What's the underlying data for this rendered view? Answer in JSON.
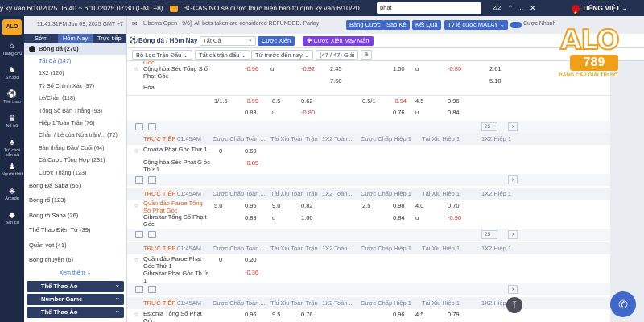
{
  "topbar": {
    "marquee": "ỳ kỳ vào 6/10/2025 06:40 ~ 6/10/2025 07:30 (GMT+8)",
    "notice": "BGCASINO sẽ được thực hiện bảo trì định kỳ vào 6/10/20",
    "search_value": "phạt",
    "page_indicator": "2/2",
    "language": "TIẾNG VIỆT"
  },
  "rail": {
    "logo": "ALO",
    "items": [
      "Trang chủ",
      "SV388",
      "Thể thao",
      "Nổ hũ",
      "Trò chơi bắn cá",
      "Người thật",
      "Arcade",
      "Bắn cá"
    ]
  },
  "sidebar": {
    "timestamp": "11:41:31PM Jun 09, 2025 GMT +7",
    "tabs": [
      "Sớm",
      "Hôm Nay",
      "Trực tiếp"
    ],
    "sport_head": "Bóng đá (270)",
    "sub_items": [
      "Tất Cả (147)",
      "1X2 (120)",
      "Tỷ Số Chính Xác (97)",
      "Lẻ/Chẵn (118)",
      "Tổng Số Bàn Thắng (93)",
      "Hiệp 1/Toàn Trận (76)",
      "Chẵn / Lẻ của Nửa trận/... (72)",
      "Bàn thắng Đầu/ Cuối (64)",
      "Cả Cược Tổng Hợp (231)",
      "Cược Thắng (123)"
    ],
    "others": [
      {
        "label": "Bóng Đá Saba (56)",
        "color": "#e05a1e"
      },
      {
        "label": "Bóng rổ (123)",
        "color": "#f08a24"
      },
      {
        "label": "Bóng rổ Saba (26)",
        "color": "#f08a24"
      },
      {
        "label": "Thể Thao Điện Tử (39)",
        "color": "#7a8599"
      },
      {
        "label": "Quần vợt (41)",
        "color": "#9bc53d"
      },
      {
        "label": "Bóng chuyền (6)",
        "color": "#3f68c9"
      }
    ],
    "more": "Xem thêm",
    "bands": [
      "Thể Thao Ảo",
      "Number Game",
      "Thể Thao Ảo"
    ]
  },
  "header": {
    "announcement": "Libema Open - 9/6]. All bets taken are considered REFUNDED. Parlay",
    "buttons": [
      "Bảng Cược",
      "Sao Kê",
      "Kết Quả",
      "Tỷ lệ cược MALAY"
    ],
    "toggle_label": "Cược Nhanh",
    "extra_label": "Chế độ gốc tối"
  },
  "filterbar": {
    "title": "Bóng đá / Hôm Nay",
    "select": "Tất Cả",
    "btn_parlay": "Cược Xiên",
    "btn_lucky": "Cược Xiên May Mắn"
  },
  "controls": {
    "filter": "Bộ Lọc Trận Đấu",
    "all_matches": "Tất cả trận đấu",
    "sort": "Từ trước đến nay",
    "count": "(47 / 47) Giải"
  },
  "headers": [
    "Cược Chấp Toàn ...",
    "Tài Xỉu Toàn Trận",
    "1X2 Toàn ...",
    "Cược Chấp Hiệp 1",
    "Tài Xỉu Hiệp 1",
    "1X2 Hiệp 1"
  ],
  "live": "TRỰC TIẾP",
  "blocks": {
    "b0": {
      "top_label": "Góc",
      "home": "Cộng hòa Séc Tổng S ố Phạt Góc",
      "draw": "Hòa",
      "r1": {
        "a": "-0.96",
        "b": "u",
        "c": "-0.92",
        "d": "2.45",
        "e": "1.00",
        "f": "u",
        "g": "-0.85",
        "h": "2.61"
      },
      "r2": {
        "d": "7.50",
        "h": "5.10"
      },
      "r3": {
        "a": "1/1.5",
        "b": "-0.99",
        "c": "8.5",
        "d": "0.62",
        "e": "0.5/1",
        "f": "-0.94",
        "g": "4.5",
        "h": "0.96"
      },
      "r4": {
        "b": "0.83",
        "c": "u",
        "d": "-0.80",
        "f": "0.76",
        "g": "u",
        "h": "0.84"
      }
    },
    "b1": {
      "time": "01:45AM",
      "home": "Croatia Phạt Góc Thứ 1",
      "away": "Cộng hòa Séc Phạt G óc Thứ 1",
      "home_line": "0",
      "home_odd": "0.69",
      "away_odd": "-0.85"
    },
    "b2": {
      "time": "01:45AM",
      "home": "Quần đảo Faroe Tổng Số Phạt Góc",
      "away": "Gibraltar Tổng Số Phạ t Góc",
      "r1": {
        "a": "5.0",
        "b": "0.95",
        "c": "9.0",
        "d": "0.82",
        "e": "2.5",
        "f": "0.98",
        "g": "4.0",
        "h": "0.70"
      },
      "r2": {
        "b": "0.89",
        "c": "u",
        "d": "1.00",
        "f": "0.84",
        "g": "u",
        "h": "-0.90"
      }
    },
    "b3": {
      "time": "01:45AM",
      "home": "Quần đảo Faroe Phạt Góc Thứ 1",
      "away": "Gibraltar Phạt Góc Th ứ 1",
      "home_line": "0",
      "home_odd": "0.20",
      "away_odd": "-0.36"
    },
    "b4": {
      "time": "01:45AM",
      "home": "Estonia Tổng Số Phạt Góc",
      "r1": {
        "b": "0.96",
        "c": "9.5",
        "d": "0.76",
        "f": "0.96",
        "g": "4.5",
        "h": "0.79"
      }
    }
  },
  "pager": "25",
  "brand": {
    "name": "ALO",
    "number": "789",
    "slogan": "ĐẲNG CẤP GIẢI TRÍ SỐ"
  },
  "colors": {
    "navy": "#23304f",
    "accent": "#3f68c9",
    "orange": "#f0a018",
    "negative": "#e0302f",
    "purple": "#7b3fe4"
  }
}
